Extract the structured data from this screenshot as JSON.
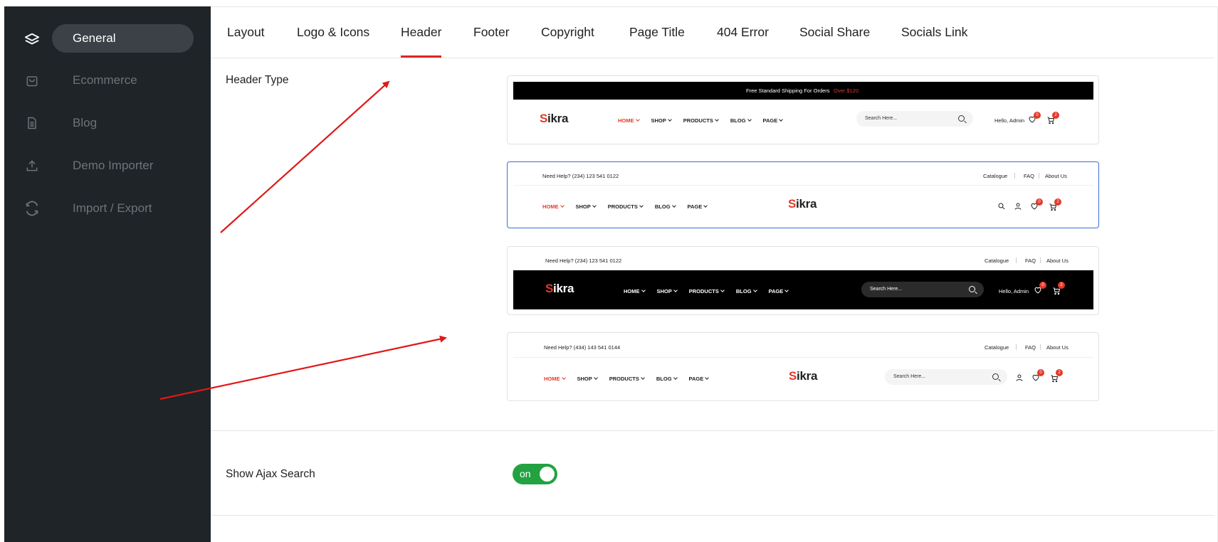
{
  "sidebar": {
    "items": [
      {
        "label": "General",
        "icon": "layers-icon",
        "active": true
      },
      {
        "label": "Ecommerce",
        "icon": "shopping-bag-icon"
      },
      {
        "label": "Blog",
        "icon": "document-icon"
      },
      {
        "label": "Demo Importer",
        "icon": "upload-icon"
      },
      {
        "label": "Import / Export",
        "icon": "sync-icon"
      }
    ]
  },
  "tabs": [
    {
      "label": "Layout"
    },
    {
      "label": "Logo & Icons"
    },
    {
      "label": "Header",
      "active": true
    },
    {
      "label": "Footer"
    },
    {
      "label": "Copyright"
    },
    {
      "label": "Page Title"
    },
    {
      "label": "404 Error"
    },
    {
      "label": "Social Share"
    },
    {
      "label": "Socials Link"
    }
  ],
  "header_type": {
    "label": "Header Type",
    "options": [
      {
        "promo": "Free Standard Shipping For Orders ",
        "promo_highlight": "Over $120",
        "logo_s": "S",
        "logo_rest": "ikra",
        "nav": [
          "HOME",
          "SHOP",
          "PRODUCTS",
          "BLOG",
          "PAGE"
        ],
        "search_placeholder": "Search Here...",
        "greeting": "Hello, Admin",
        "wishlist_count": "0",
        "cart_count": "2"
      },
      {
        "help": "Need Help? (234) 123 541 0122",
        "links": [
          "Catalogue",
          "FAQ",
          "About Us"
        ],
        "logo_s": "S",
        "logo_rest": "ikra",
        "nav": [
          "HOME",
          "SHOP",
          "PRODUCTS",
          "BLOG",
          "PAGE"
        ],
        "wishlist_count": "0",
        "cart_count": "2",
        "selected": true
      },
      {
        "help": "Need Help? (234) 123 541 0122",
        "links": [
          "Catalogue",
          "FAQ",
          "About Us"
        ],
        "logo_s": "S",
        "logo_rest": "ikra",
        "nav": [
          "HOME",
          "SHOP",
          "PRODUCTS",
          "BLOG",
          "PAGE"
        ],
        "search_placeholder": "Search Here...",
        "greeting": "Hello, Admin",
        "wishlist_count": "0",
        "cart_count": "2"
      },
      {
        "help": "Need Help? (434) 143 541 0144",
        "links": [
          "Catalogue",
          "FAQ",
          "About Us"
        ],
        "logo_s": "S",
        "logo_rest": "ikra",
        "nav": [
          "HOME",
          "SHOP",
          "PRODUCTS",
          "BLOG",
          "PAGE"
        ],
        "search_placeholder": "Search Here...",
        "wishlist_count": "0",
        "cart_count": "2"
      }
    ]
  },
  "ajax_search": {
    "label": "Show Ajax Search",
    "toggle_label": "on",
    "enabled": true
  },
  "colors": {
    "sidebar_bg": "#1f2428",
    "accent_red": "#e33a2a",
    "toggle_green": "#22a241",
    "selected_border": "#3b6fd8"
  }
}
